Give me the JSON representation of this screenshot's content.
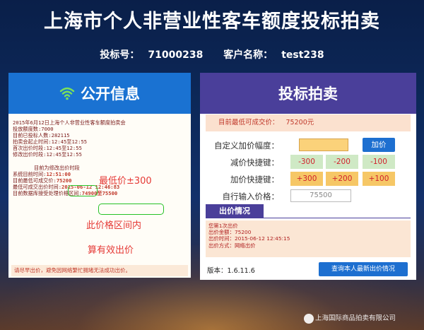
{
  "page": {
    "title": "上海市个人非营业性客车额度投标拍卖",
    "bid_number_label": "投标号：",
    "bid_number": "71000238",
    "customer_label": "客户名称：",
    "customer_name": "test238",
    "watermark": "上海国际商品拍卖有限公司"
  },
  "left_panel": {
    "title": "公开信息",
    "lines": [
      "2015年6月12日上海个人非营业性客车额度拍卖会",
      "投放额度数:7000",
      "目前已投标人数:282115",
      "拍卖会起止时间:12:45至12:55",
      "首次出价时段:12:45至12:55",
      "修改出价时段:12:45至12:55"
    ],
    "sub_header": "目前为修改出价时段",
    "sys_time_label": "系统目前时间:",
    "sys_time": "12:51:00",
    "lowest_label": "目前最低可成交价:",
    "lowest_value": "75200",
    "lowest_time_label": "最低可成交出价时间:",
    "lowest_time": "2015-06-12 12:46:83",
    "range_label": "目前数据库接受处理价格区间:",
    "range_value": "74900至75500",
    "note_lowest": "最低价±300",
    "note_range": "此价格区间内",
    "note_valid": "算有效出价",
    "footer": "请尽早出价，避免因网络繁忙拥堵无法成功出价。"
  },
  "right_panel": {
    "title": "投标拍卖",
    "lowest_label": "目前最低可成交价：",
    "lowest_value": "75200元",
    "custom_label": "自定义加价幅度：",
    "add_button": "加价",
    "minus_label": "减价快捷键：",
    "minus_buttons": [
      "-300",
      "-200",
      "-100"
    ],
    "plus_label": "加价快捷键：",
    "plus_buttons": [
      "+300",
      "+200",
      "+100"
    ],
    "input_label": "自行输入价格：",
    "input_value": "75500",
    "section_title": "出价情况",
    "bid_info": [
      "您第1次出价",
      "出价金额：75200",
      "出价时间：2015-06-12 12:45:15",
      "出价方式：网络出价"
    ],
    "version": "版本：1.6.11.6",
    "query_button": "查询本人最新出价情况"
  },
  "colors": {
    "left_header": "#1a72d2",
    "right_header": "#4a3f9a",
    "accent_red": "#e53935",
    "highlight_green": "#27c227"
  },
  "icons": {
    "left_header_icon": "wifi-icon"
  }
}
